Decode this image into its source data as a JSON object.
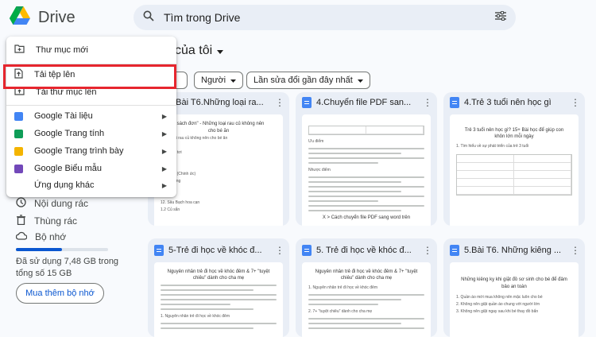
{
  "header": {
    "app_name": "Drive",
    "search_placeholder": "Tìm trong Drive"
  },
  "sidebar": {
    "items": [
      {
        "label": "Nội dung rác",
        "icon": "clock-icon"
      },
      {
        "label": "Thùng rác",
        "icon": "trash-icon"
      },
      {
        "label": "Bộ nhớ",
        "icon": "cloud-icon"
      }
    ],
    "storage_text": "Đã sử dụng 7,48 GB trong tổng số 15 GB",
    "storage_fraction": 0.4987,
    "buy_button": "Mua thêm bộ nhớ"
  },
  "main": {
    "title": "của tôi",
    "filters": [
      "Người",
      "Lần sửa đổi gần đây nhất"
    ]
  },
  "menu": {
    "items": [
      {
        "label": "Thư mục mới",
        "icon": "new-folder-icon"
      },
      {
        "label": "Tải tệp lên",
        "icon": "file-upload-icon"
      },
      {
        "label": "Tải thư mục lên",
        "icon": "folder-upload-icon"
      },
      {
        "label": "Google Tài liệu",
        "icon": "google-docs-icon",
        "color": "#4285f4"
      },
      {
        "label": "Google Trang tính",
        "icon": "google-sheets-icon",
        "color": "#0f9d58"
      },
      {
        "label": "Google Trang trình bày",
        "icon": "google-slides-icon",
        "color": "#f4b400"
      },
      {
        "label": "Google Biểu mẫu",
        "icon": "google-forms-icon",
        "color": "#7248b9"
      },
      {
        "label": "Ứng dụng khác",
        "icon": "more-apps-icon"
      }
    ]
  },
  "cards": [
    {
      "title": "4.Bài T6.Những loại ra...",
      "preview": [
        "h sách đơn\" - Những loại rau củ không nên",
        "cho bé ăn",
        "hững loại rau củ không nên cho bé ăn",
        "rau",
        "au mồng tơi",
        "au dền",
        "au mùi",
        "iểu đắng (Chinh ức)",
        "i khoai lang",
        "ng Sâm",
        "Rau giả",
        "12. Sâu Bạch hoa cạn",
        "1.2 Củ sắn"
      ]
    },
    {
      "title": "4.Chuyển file PDF san...",
      "preview": [
        "Ưu điểm",
        "Nhược điểm",
        "X > Cách chuyển file PDF sang word trên"
      ]
    },
    {
      "title": "4.Trẻ 3 tuổi nên học gì",
      "preview": [
        "Trẻ 3 tuổi nên học gì? 15+ Bài học để giúp con",
        "khôn lớn mỗi ngày",
        "1. Tìm hiểu về sự phát triển của trẻ 3 tuổi"
      ]
    },
    {
      "title": "5-Trẻ đi học về khóc đ...",
      "preview": [
        "Nguyên nhân trẻ đi học về khóc đêm & 7+ \"tuyệt",
        "chiêu\" dành cho cha mẹ",
        "1. Nguyên nhân trẻ đi học về khóc đêm"
      ]
    },
    {
      "title": "5. Trẻ đi học về khóc đ...",
      "preview": [
        "Nguyên nhân trẻ đi học về khóc đêm & 7+ \"tuyệt",
        "chiêu\" dành cho cha mẹ",
        "1. Nguyên nhân trẻ đi học về khóc đêm",
        "2. 7+ \"tuyệt chiêu\" dành cho cha mẹ"
      ]
    },
    {
      "title": "5.Bài T6. Những kiêng ...",
      "preview": [
        "Những kiêng kỵ khi giặt đồ sơ sinh cho bé để đảm",
        "bảo an toàn",
        "1. Quần áo mới mua không nên mặc luôn cho bé",
        "2. Không nên giặt quần áo chung với người lớn",
        "3. Không nên giặt ngay sau khi bé thay đồ bẩn"
      ]
    }
  ]
}
